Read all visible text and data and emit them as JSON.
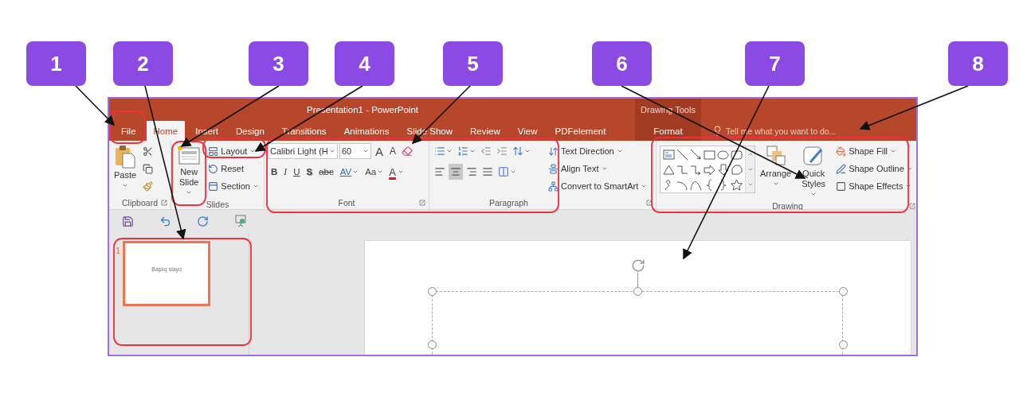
{
  "annotations": {
    "badges": [
      "1",
      "2",
      "3",
      "4",
      "5",
      "6",
      "7",
      "8"
    ]
  },
  "window": {
    "title": "Presentation1 - PowerPoint"
  },
  "tabs": [
    {
      "label": "File",
      "selected": false
    },
    {
      "label": "Home",
      "selected": true
    },
    {
      "label": "Insert",
      "selected": false
    },
    {
      "label": "Design",
      "selected": false
    },
    {
      "label": "Transitions",
      "selected": false
    },
    {
      "label": "Animations",
      "selected": false
    },
    {
      "label": "Slide Show",
      "selected": false
    },
    {
      "label": "Review",
      "selected": false
    },
    {
      "label": "View",
      "selected": false
    },
    {
      "label": "PDFelement",
      "selected": false
    }
  ],
  "contextual": {
    "title": "Drawing Tools",
    "tabs": [
      {
        "label": "Format",
        "selected": false
      }
    ]
  },
  "tell_me": {
    "placeholder": "Tell me what you want to do..."
  },
  "ribbon": {
    "clipboard": {
      "label": "Clipboard",
      "paste": "Paste"
    },
    "slides": {
      "label": "Slides",
      "new_slide": "New Slide",
      "commands": [
        "Layout",
        "Reset",
        "Section"
      ]
    },
    "font": {
      "label": "Font",
      "font_name": "Calibri Light (H",
      "font_size": "60",
      "grow": "A",
      "shrink": "A",
      "styles": [
        "B",
        "I",
        "U",
        "S",
        "abc",
        "AV",
        "Aa"
      ],
      "font_color": "A"
    },
    "paragraph": {
      "label": "Paragraph",
      "align": [
        {
          "kind": "left",
          "selected": false
        },
        {
          "kind": "center",
          "selected": true
        },
        {
          "kind": "right",
          "selected": false
        },
        {
          "kind": "justify",
          "selected": false
        }
      ],
      "commands": [
        "Text Direction",
        "Align Text",
        "Convert to SmartArt"
      ]
    },
    "drawing": {
      "label": "Drawing",
      "arrange": "Arrange",
      "quick_styles": "Quick Styles",
      "commands": [
        "Shape Fill",
        "Shape Outline",
        "Shape Effects"
      ]
    }
  },
  "slides_panel": {
    "thumbnails": [
      {
        "number": "1",
        "title": "Başlıq slayd",
        "selected": true
      }
    ]
  }
}
